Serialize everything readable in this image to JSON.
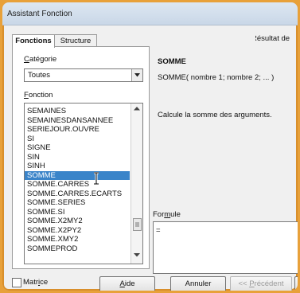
{
  "window": {
    "title": "Assistant Fonction"
  },
  "tabs": [
    {
      "label": "Fonctions"
    },
    {
      "label": "Structure"
    }
  ],
  "result_label": "Résultat de",
  "category": {
    "label_prefix": "C",
    "label_rest": "atégorie",
    "selected": "Toutes"
  },
  "function_list": {
    "label_prefix": "F",
    "label_rest": "onction",
    "items": [
      "SEMAINES",
      "SEMAINESDANSANNEE",
      "SERIEJOUR.OUVRE",
      "SI",
      "SIGNE",
      "SIN",
      "SINH",
      "SOMME",
      "SOMME.CARRES",
      "SOMME.CARRES.ECARTS",
      "SOMME.SERIES",
      "SOMME.SI",
      "SOMME.X2MY2",
      "SOMME.X2PY2",
      "SOMME.XMY2",
      "SOMMEPROD"
    ],
    "selected_index": 7
  },
  "function_info": {
    "name": "SOMME",
    "syntax": "SOMME( nombre 1; nombre 2; ... )",
    "description": "Calcule la somme des arguments."
  },
  "formula": {
    "label_prefix": "For",
    "label_u": "m",
    "label_rest": "ule",
    "value": "="
  },
  "matrix": {
    "label_prefix": "Matr",
    "label_u": "i",
    "label_rest": "ce"
  },
  "buttons": {
    "help_u": "A",
    "help_rest": "ide",
    "cancel": "Annuler",
    "prev_prefix": "<< ",
    "prev_u": "P",
    "prev_rest": "récédent"
  }
}
